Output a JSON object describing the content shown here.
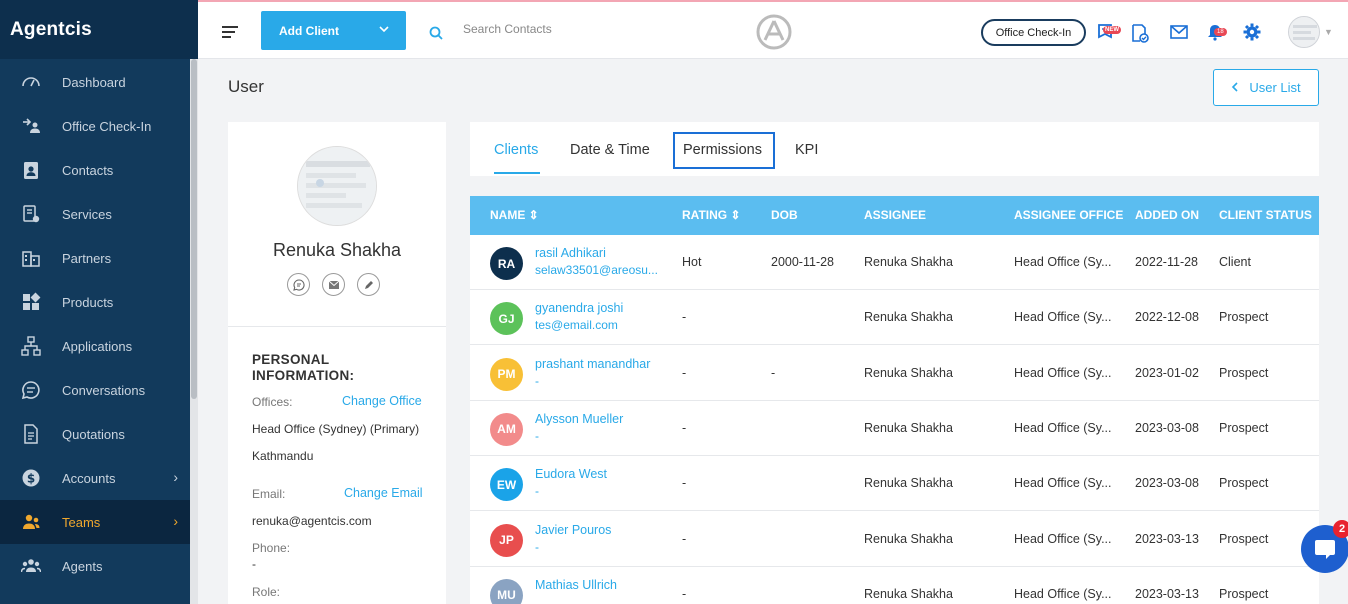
{
  "brand": "Agentcis",
  "sidebar": {
    "items": [
      {
        "label": "Dashboard",
        "icon": "gauge-icon"
      },
      {
        "label": "Office Check-In",
        "icon": "checkin-icon"
      },
      {
        "label": "Contacts",
        "icon": "contact-card-icon"
      },
      {
        "label": "Services",
        "icon": "services-icon"
      },
      {
        "label": "Partners",
        "icon": "building-icon"
      },
      {
        "label": "Products",
        "icon": "grid-icon"
      },
      {
        "label": "Applications",
        "icon": "flow-icon"
      },
      {
        "label": "Conversations",
        "icon": "chat-icon"
      },
      {
        "label": "Quotations",
        "icon": "document-icon"
      },
      {
        "label": "Accounts",
        "icon": "dollar-icon"
      },
      {
        "label": "Teams",
        "icon": "team-icon"
      },
      {
        "label": "Agents",
        "icon": "agents-icon"
      }
    ],
    "active": "Teams"
  },
  "header": {
    "add_client_label": "Add Client",
    "search_placeholder": "Search Contacts",
    "office_checkin_label": "Office Check-In",
    "new_badge": "NEW",
    "notification_count": "18"
  },
  "page": {
    "title": "User",
    "user_list_label": "User List"
  },
  "profile": {
    "name": "Renuka Shakha",
    "personal_info_heading": "PERSONAL INFORMATION:",
    "offices_label": "Offices:",
    "change_office_label": "Change Office",
    "office_primary": "Head Office (Sydney) (Primary)",
    "office_secondary": "Kathmandu",
    "email_label": "Email:",
    "change_email_label": "Change Email",
    "email_value": "renuka@agentcis.com",
    "phone_label": "Phone:",
    "phone_value": "-",
    "role_label": "Role:"
  },
  "tabs": [
    {
      "label": "Clients",
      "active": true
    },
    {
      "label": "Date & Time",
      "active": false
    },
    {
      "label": "Permissions",
      "active": false
    },
    {
      "label": "KPI",
      "active": false
    }
  ],
  "table": {
    "headers": {
      "name": "NAME ⇕",
      "rating": "RATING ⇕",
      "dob": "DOB",
      "assignee": "ASSIGNEE",
      "assignee_office": "ASSIGNEE OFFICE",
      "added_on": "ADDED ON",
      "client_status": "CLIENT STATUS"
    },
    "rows": [
      {
        "initials": "RA",
        "color": "#0d2f4d",
        "name": "rasil Adhikari",
        "email": "selaw33501@areosu...",
        "rating": "Hot",
        "dob": "2000-11-28",
        "assignee": "Renuka Shakha",
        "office": "Head Office (Sy...",
        "added": "2022-11-28",
        "status": "Client"
      },
      {
        "initials": "GJ",
        "color": "#5cc25a",
        "name": "gyanendra joshi",
        "email": "tes@email.com",
        "rating": "-",
        "dob": "",
        "assignee": "Renuka Shakha",
        "office": "Head Office (Sy...",
        "added": "2022-12-08",
        "status": "Prospect"
      },
      {
        "initials": "PM",
        "color": "#f8c036",
        "name": "prashant manandhar",
        "email": "-",
        "rating": "-",
        "dob": "-",
        "assignee": "Renuka Shakha",
        "office": "Head Office (Sy...",
        "added": "2023-01-02",
        "status": "Prospect"
      },
      {
        "initials": "AM",
        "color": "#f28b8b",
        "name": "Alysson Mueller",
        "email": "-",
        "rating": "-",
        "dob": "",
        "assignee": "Renuka Shakha",
        "office": "Head Office (Sy...",
        "added": "2023-03-08",
        "status": "Prospect"
      },
      {
        "initials": "EW",
        "color": "#1aa3e8",
        "name": "Eudora West",
        "email": "-",
        "rating": "-",
        "dob": "",
        "assignee": "Renuka Shakha",
        "office": "Head Office (Sy...",
        "added": "2023-03-08",
        "status": "Prospect"
      },
      {
        "initials": "JP",
        "color": "#e84e4e",
        "name": "Javier Pouros",
        "email": "-",
        "rating": "-",
        "dob": "",
        "assignee": "Renuka Shakha",
        "office": "Head Office (Sy...",
        "added": "2023-03-13",
        "status": "Prospect"
      },
      {
        "initials": "MU",
        "color": "#8aa3c2",
        "name": "Mathias Ullrich",
        "email": "",
        "rating": "-",
        "dob": "",
        "assignee": "Renuka Shakha",
        "office": "Head Office (Sy...",
        "added": "2023-03-13",
        "status": "Prospect"
      }
    ]
  },
  "chat": {
    "badge": "2"
  },
  "colors": {
    "sidebar": "#123a5c",
    "accent": "#29a9e8",
    "active_nav": "#f0a82e",
    "table_header": "#5bbdf0"
  }
}
